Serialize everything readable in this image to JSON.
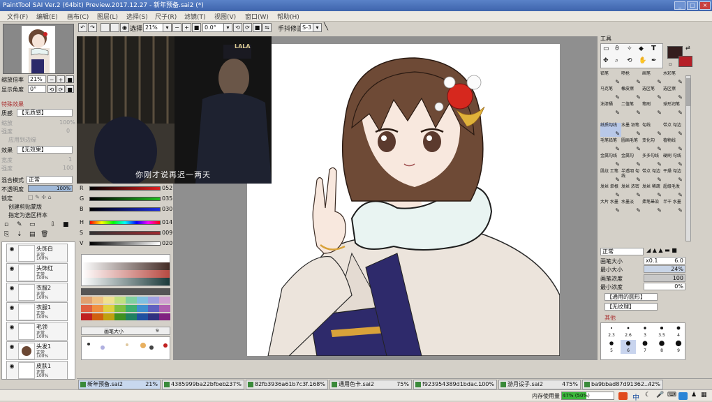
{
  "window": {
    "title": "PaintTool SAI Ver.2 (64bit) Preview.2017.12.27 - 新年预备.sai2 (*)"
  },
  "menu": [
    "文件(F)",
    "编辑(E)",
    "画布(C)",
    "图层(L)",
    "选择(S)",
    "尺子(R)",
    "滤镜(T)",
    "视图(V)",
    "窗口(W)",
    "帮助(H)"
  ],
  "toolbar": {
    "select_label": "选择",
    "zoom_value": "21%",
    "angle_value": "0.0°",
    "stabilizer_label": "手抖修正",
    "stabilizer_value": "S-3"
  },
  "navigator": {
    "zoom_label": "缩放倍率",
    "zoom_value": "21%",
    "angle_label": "显示角度",
    "angle_value": "0°"
  },
  "layer_props": {
    "special_effect_header": "特殊效果",
    "texture_label": "质感",
    "texture_value": "【无质感】",
    "scale_label": "缩放",
    "scale_value": "100%",
    "strength_label": "强度",
    "strength_value": "0",
    "apply_border_label": "应用到边缘",
    "effect_label": "效果",
    "effect_value": "【无效果】",
    "width_label": "宽度",
    "width_value": "1",
    "intensity_label": "强度",
    "intensity_value": "100",
    "blend_label": "混合模式",
    "blend_value": "正常",
    "opacity_label": "不透明度",
    "opacity_value": "100%",
    "lock_label": "锁定",
    "clip_label": "创建剪贴蒙版",
    "sample_label": "指定为选区样本"
  },
  "layers": [
    {
      "name": "头饰白",
      "mode": "正常",
      "opacity": "100%"
    },
    {
      "name": "头饰红",
      "mode": "正常",
      "opacity": "100%"
    },
    {
      "name": "衣服2",
      "mode": "正常",
      "opacity": "100%"
    },
    {
      "name": "衣服1",
      "mode": "正常",
      "opacity": "100%"
    },
    {
      "name": "毛领",
      "mode": "正常",
      "opacity": "100%"
    },
    {
      "name": "头发1",
      "mode": "正常",
      "opacity": "100%"
    },
    {
      "name": "皮肤1",
      "mode": "正常",
      "opacity": "100%"
    }
  ],
  "video": {
    "subtitle": "你刚才说再迟一两天",
    "watermark": "LALA"
  },
  "color": {
    "sliders": [
      {
        "label": "R",
        "value": "052",
        "color": "#d02020"
      },
      {
        "label": "G",
        "value": "035",
        "color": "#20b020"
      },
      {
        "label": "B",
        "value": "030",
        "color": "#2030d0"
      },
      {
        "label": "H",
        "value": "014",
        "color": "#e0a020"
      },
      {
        "label": "S",
        "value": "009",
        "color": "#b0303a"
      },
      {
        "label": "V",
        "value": "020",
        "color": "#6a6a6a"
      }
    ],
    "current": "#341e1e",
    "secondary": "#b51f27",
    "brush_size_label": "画笔大小",
    "brush_size_value": "9"
  },
  "tools": {
    "header": "工具",
    "brushes_row1": [
      "铅笔",
      "喷枪",
      "画笔",
      "水彩笔",
      "马克笔",
      "橡皮擦",
      "选区笔",
      "选区擦",
      "油漆桶",
      "二值笔",
      "笔刷",
      "球形润笔"
    ],
    "brushes_row2": [
      "纸质勾线",
      "水墨 铅笔",
      "勾线",
      "带点 勾边",
      "毛笔铅笔",
      "圆画毛笔",
      "变化勾",
      "植物线",
      "金属勾线",
      "金属勾",
      "多多勾线",
      "硬刷 勾线",
      "肌纹 工笔",
      "半透明 勾线",
      "带点 勾边",
      "干燥 勾边",
      "发丝 单根",
      "发丝 浓密",
      "发丝 稀疏",
      "超级毛发",
      "大片 水墨",
      "水墨淡",
      "柔笔晕染",
      "半干 水墨"
    ],
    "blend_value": "正常",
    "size_label": "画笔大小",
    "size_mult": "x0.1",
    "size_value": "6.0",
    "min_size_label": "最小大小",
    "min_size_value": "24%",
    "density_label": "画笔浓度",
    "density_value": "100",
    "min_density_label": "最小浓度",
    "min_density_value": "0%",
    "shape_value": "【通用的圆形】",
    "texture_value": "【无纹理】",
    "other_label": "其他",
    "dot_sizes": [
      "2.3",
      "2.6",
      "3",
      "3.5",
      "4",
      "5",
      "6",
      "7",
      "8",
      "9"
    ]
  },
  "tabs": [
    {
      "name": "新年预备.sai2",
      "zoom": "21%"
    },
    {
      "name": "4385999ba22bfbeb...",
      "zoom": "237%"
    },
    {
      "name": "82fb3936a61b7c3f...",
      "zoom": "168%"
    },
    {
      "name": "通用色卡.sai2",
      "zoom": "75%"
    },
    {
      "name": "f923954389d1bdac...",
      "zoom": "100%"
    },
    {
      "name": "游月设子.sai2",
      "zoom": "475%"
    },
    {
      "name": "ba9bbad87d91362...",
      "zoom": "42%"
    }
  ],
  "status": {
    "memory_label": "内存使用量",
    "memory_value": "47% (50%)",
    "ime": "中"
  }
}
